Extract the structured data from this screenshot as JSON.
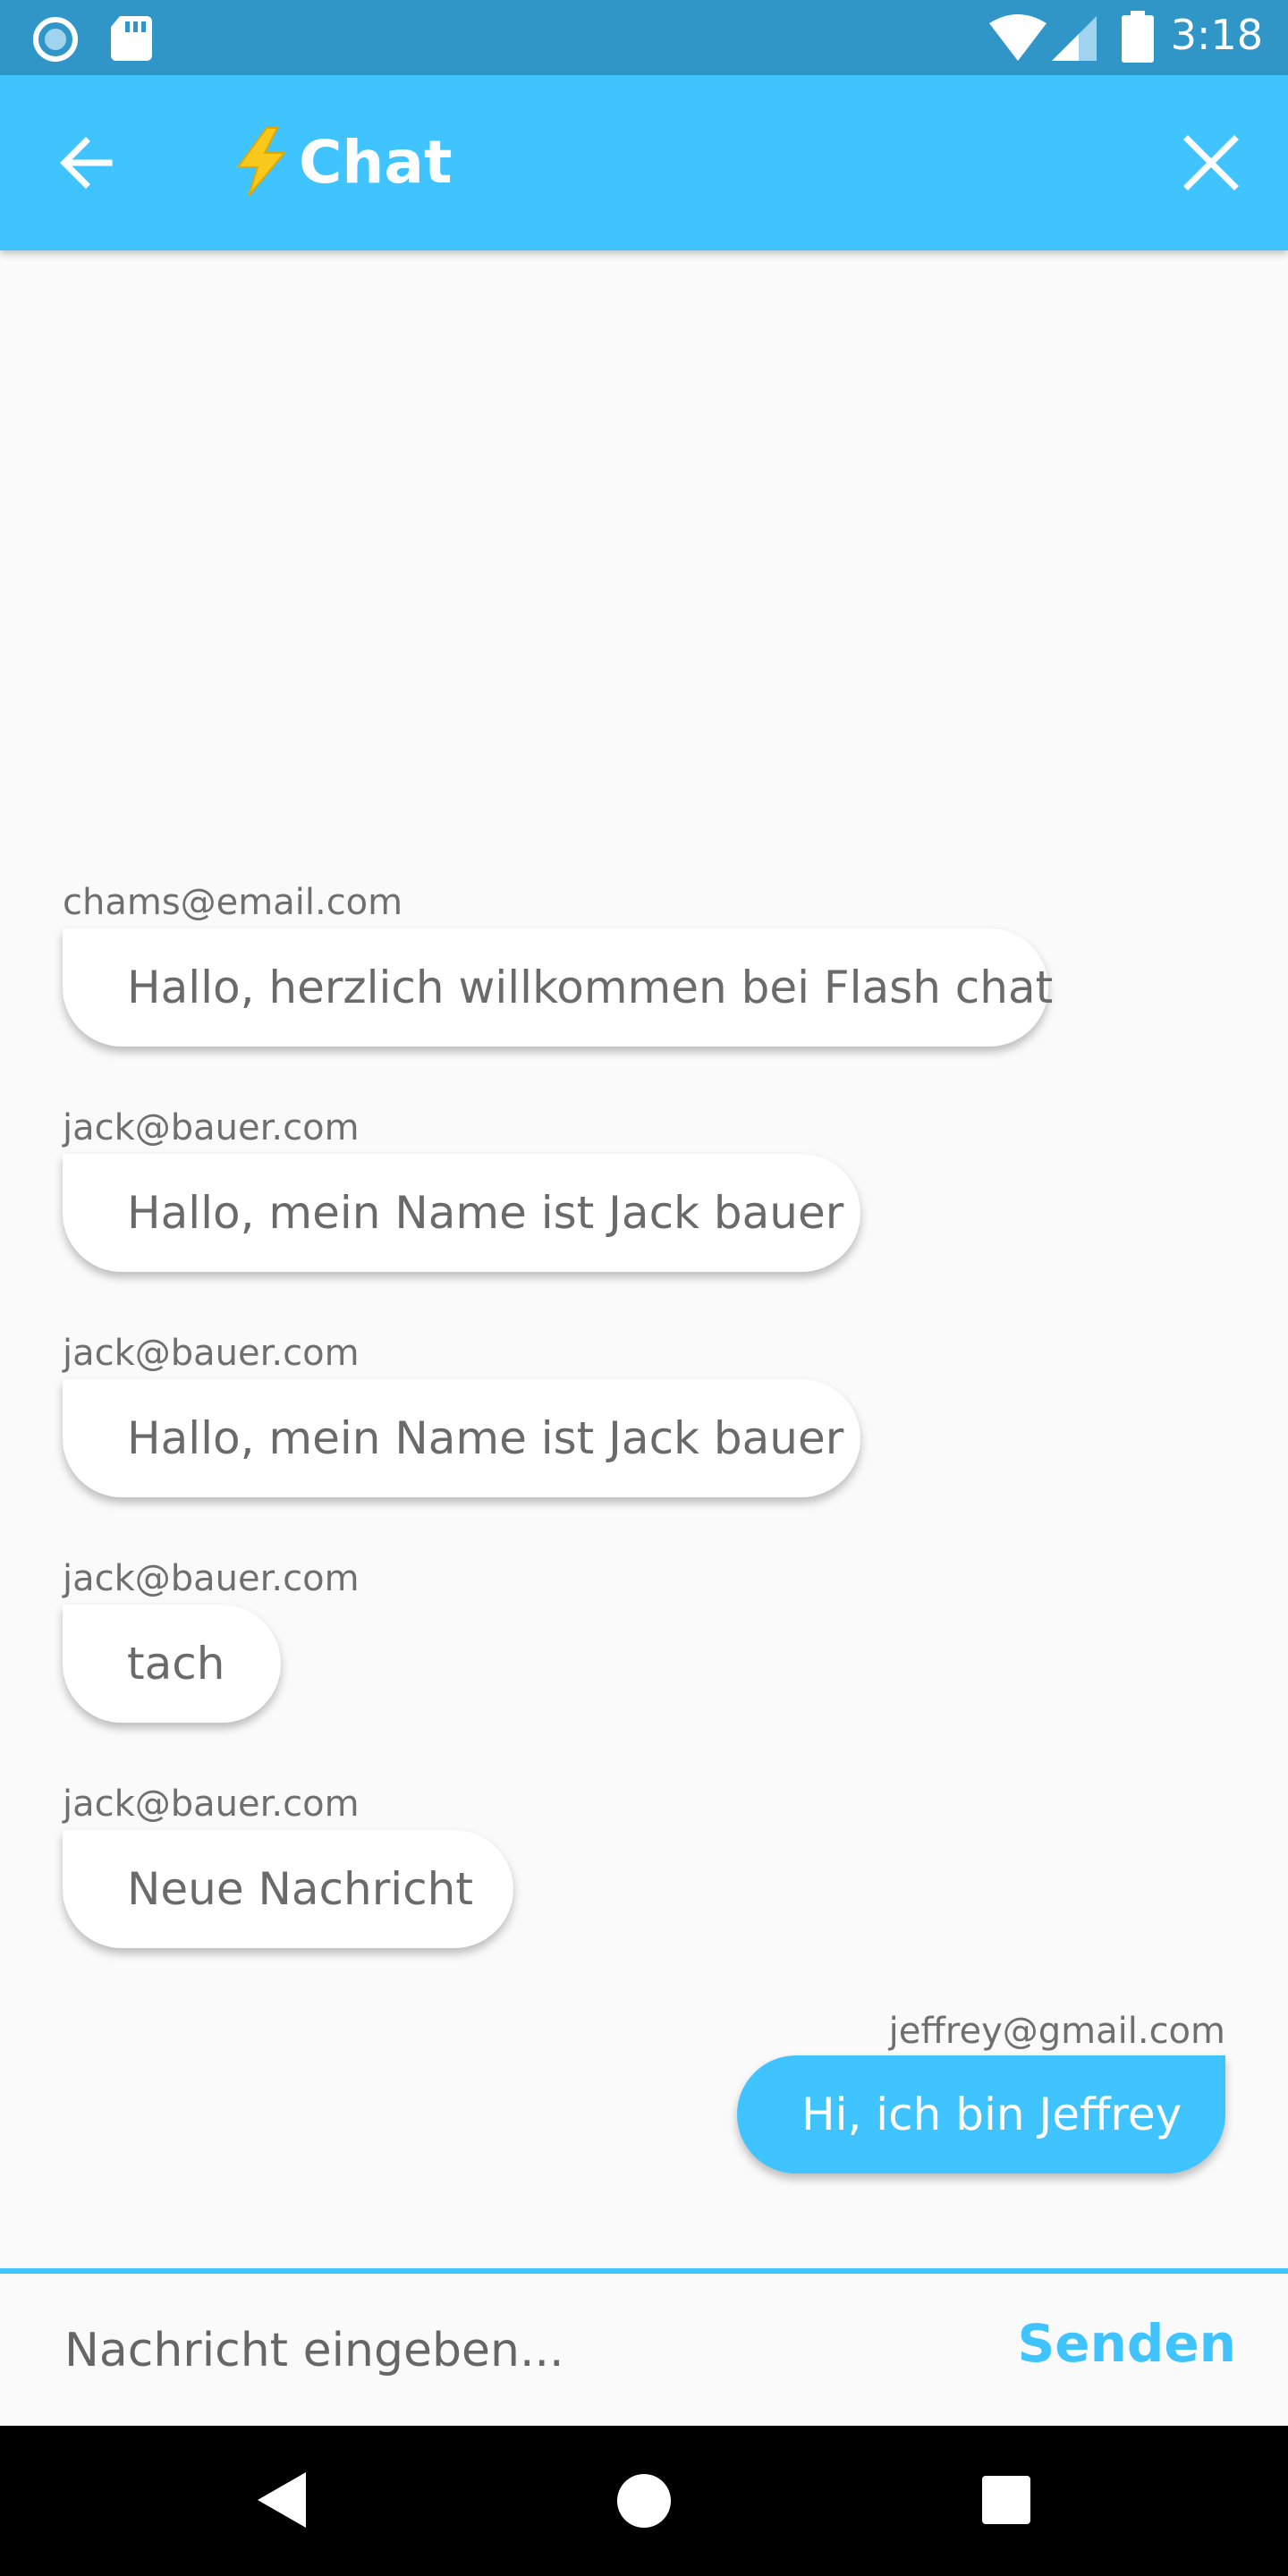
{
  "status_bar": {
    "time": "3:18",
    "icons": [
      "notification-circle-icon",
      "sd-card-icon",
      "wifi-icon",
      "cellular-signal-icon",
      "battery-icon"
    ]
  },
  "app_bar": {
    "title": "Chat",
    "title_icon": "lightning-bolt-icon",
    "back_icon": "arrow-back-icon",
    "close_icon": "close-icon",
    "background_color": "#40c4ff"
  },
  "messages": [
    {
      "sender": "chams@email.com",
      "text": "Hallo, herzlich willkommen bei Flash chat",
      "is_me": false
    },
    {
      "sender": "jack@bauer.com",
      "text": "Hallo, mein Name ist Jack bauer",
      "is_me": false
    },
    {
      "sender": "jack@bauer.com",
      "text": "Hallo, mein Name ist Jack bauer",
      "is_me": false
    },
    {
      "sender": "jack@bauer.com",
      "text": "tach",
      "is_me": false
    },
    {
      "sender": "jack@bauer.com",
      "text": "Neue Nachricht",
      "is_me": false
    },
    {
      "sender": "jeffrey@gmail.com",
      "text": "Hi, ich bin Jeffrey",
      "is_me": true
    }
  ],
  "composer": {
    "placeholder": "Nachricht eingeben...",
    "value": "",
    "send_label": "Senden",
    "accent_color": "#40c4ff"
  },
  "nav_bar": {
    "icons": [
      "back-triangle-icon",
      "home-circle-icon",
      "recents-square-icon"
    ]
  }
}
